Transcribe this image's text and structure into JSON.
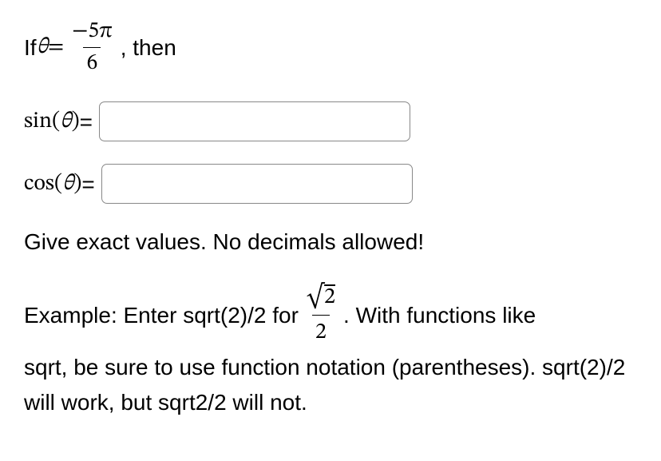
{
  "problem": {
    "prefix": "If ",
    "theta": "θ",
    "equals": " = ",
    "numerator": "−5π",
    "denominator": "6",
    "suffix": ", then"
  },
  "row_sin": {
    "func": "sin",
    "arg": "(θ)",
    "eq": " = "
  },
  "row_cos": {
    "func": "cos",
    "arg": "(θ)",
    "eq": " = "
  },
  "instruction": "Give exact values. No decimals allowed!",
  "example": {
    "part1": "Example: Enter sqrt(2)/2 for ",
    "frac_num_sqrt": "√",
    "frac_num_radicand": "2",
    "frac_den": "2",
    "part2": ". With functions like",
    "line2": "sqrt, be sure to use function notation (parentheses). sqrt(2)/2 will work, but sqrt2/2 will not."
  }
}
